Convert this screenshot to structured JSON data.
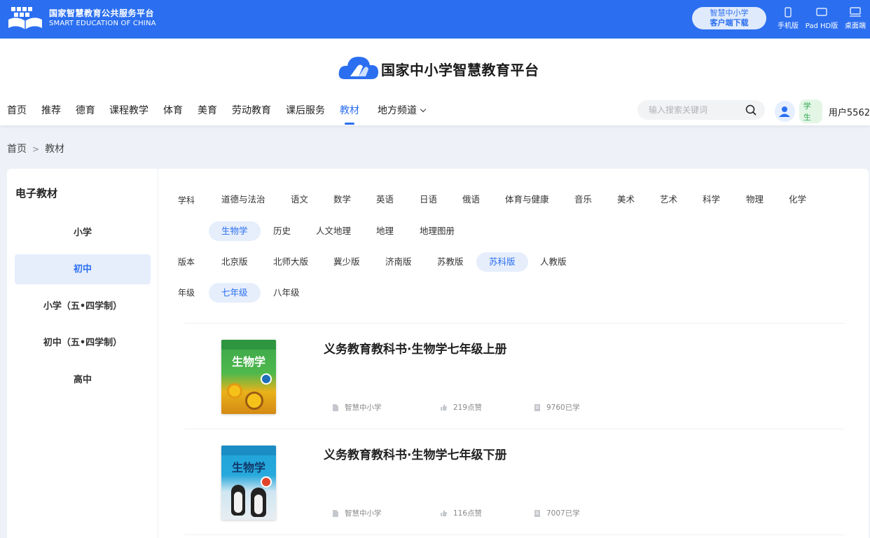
{
  "topbar": {
    "logo_cn": "国家智慧教育公共服务平台",
    "logo_en": "SMART EDUCATION OF CHINA",
    "download_line1": "智慧中小学",
    "download_line2": "客户端下载",
    "devices": [
      {
        "label": "手机版",
        "icon": "phone-icon"
      },
      {
        "label": "Pad HD版",
        "icon": "tablet-icon"
      },
      {
        "label": "桌面端",
        "icon": "desktop-icon"
      }
    ]
  },
  "header": {
    "brand": "国家中小学智慧教育平台",
    "nav": [
      "首页",
      "推荐",
      "德育",
      "课程教学",
      "体育",
      "美育",
      "劳动教育",
      "课后服务",
      "教材",
      "地方频道"
    ],
    "nav_active": "教材",
    "search_placeholder": "输入搜索关键词",
    "role": "学生",
    "username": "用户5562"
  },
  "breadcrumb": {
    "home": "首页",
    "sep": ">",
    "current": "教材"
  },
  "sidebar": {
    "title": "电子教材",
    "items": [
      "小学",
      "初中",
      "小学（五•四学制）",
      "初中（五•四学制）",
      "高中"
    ],
    "active": "初中"
  },
  "filters": {
    "subject_label": "学科",
    "subjects_row1": [
      "道德与法治",
      "语文",
      "数学",
      "英语",
      "日语",
      "俄语",
      "体育与健康",
      "音乐",
      "美术",
      "艺术",
      "科学",
      "物理",
      "化学"
    ],
    "subjects_row2": [
      "生物学",
      "历史",
      "人文地理",
      "地理",
      "地理图册"
    ],
    "subject_active": "生物学",
    "edition_label": "版本",
    "editions": [
      "北京版",
      "北师大版",
      "冀少版",
      "济南版",
      "苏教版",
      "苏科版",
      "人教版"
    ],
    "edition_active": "苏科版",
    "grade_label": "年级",
    "grades": [
      "七年级",
      "八年级"
    ],
    "grade_active": "七年级"
  },
  "books": [
    {
      "title": "义务教育教科书·生物学七年级上册",
      "cover_text": "生物学",
      "publisher": "智慧中小学",
      "likes": "219点赞",
      "learners": "9760已学"
    },
    {
      "title": "义务教育教科书·生物学七年级下册",
      "cover_text": "生物学",
      "publisher": "智慧中小学",
      "likes": "116点赞",
      "learners": "7007已学"
    }
  ],
  "colors": {
    "primary": "#2b6ff0",
    "active_bg": "#e6eefc",
    "student_badge": "#33a853"
  }
}
